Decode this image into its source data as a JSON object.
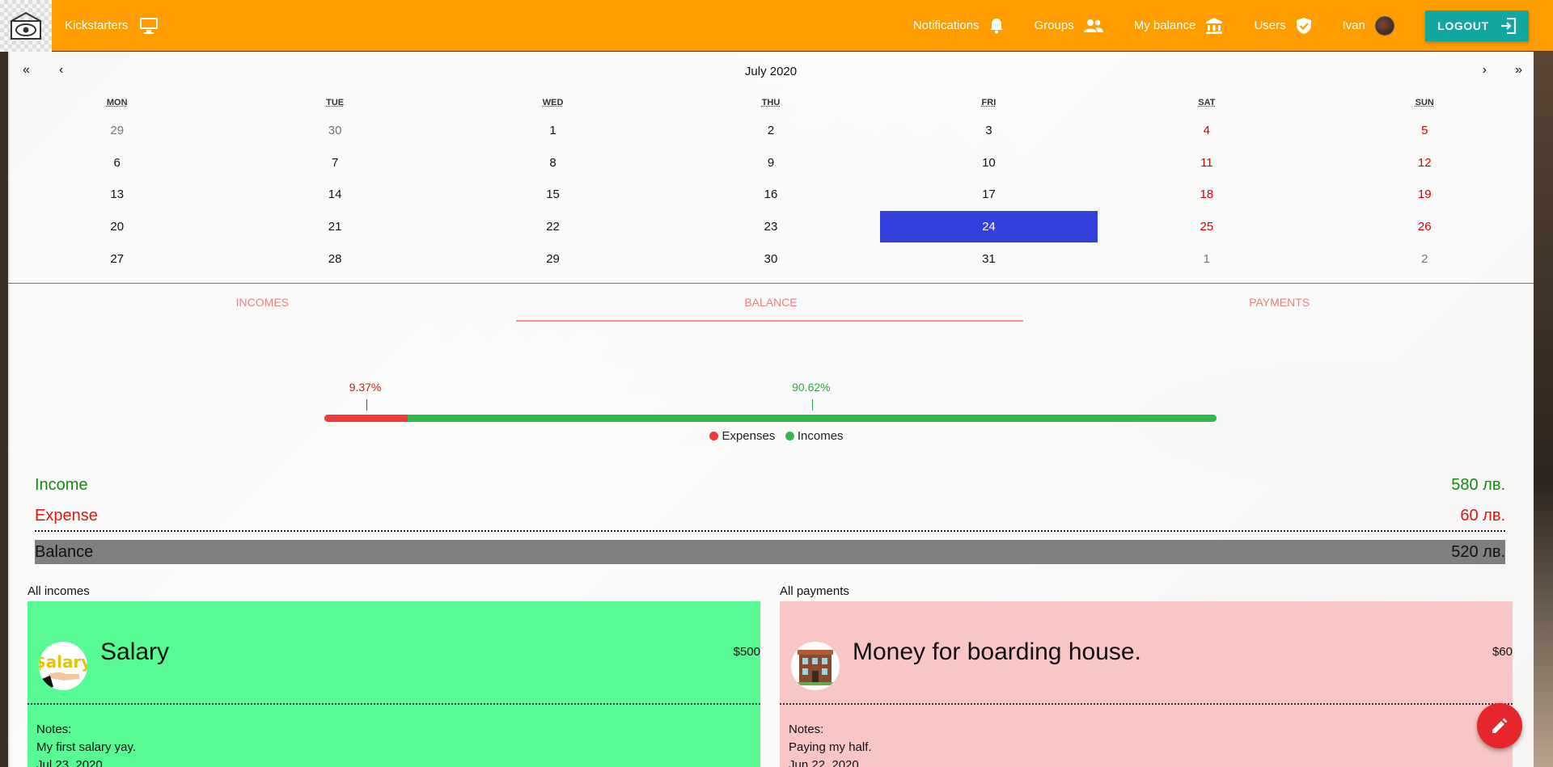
{
  "navbar": {
    "brand": "Kickstarters",
    "items": [
      {
        "label": "Notifications",
        "icon": "bell-icon"
      },
      {
        "label": "Groups",
        "icon": "groups-icon"
      },
      {
        "label": "My balance",
        "icon": "bank-icon"
      },
      {
        "label": "Users",
        "icon": "shield-check-icon"
      }
    ],
    "user": "Ivan",
    "logout": "LOGOUT",
    "color": "#ff9d00"
  },
  "calendar": {
    "title": "July 2020",
    "nav": {
      "prev_year": "«",
      "prev_month": "‹",
      "next_month": "›",
      "next_year": "»"
    },
    "weekdays": [
      "MON",
      "TUE",
      "WED",
      "THU",
      "FRI",
      "SAT",
      "SUN"
    ],
    "days": [
      {
        "d": "29",
        "t": "other"
      },
      {
        "d": "30",
        "t": "other"
      },
      {
        "d": "1",
        "t": ""
      },
      {
        "d": "2",
        "t": ""
      },
      {
        "d": "3",
        "t": ""
      },
      {
        "d": "4",
        "t": "weekend"
      },
      {
        "d": "5",
        "t": "weekend"
      },
      {
        "d": "6",
        "t": ""
      },
      {
        "d": "7",
        "t": ""
      },
      {
        "d": "8",
        "t": ""
      },
      {
        "d": "9",
        "t": ""
      },
      {
        "d": "10",
        "t": ""
      },
      {
        "d": "11",
        "t": "weekend"
      },
      {
        "d": "12",
        "t": "weekend"
      },
      {
        "d": "13",
        "t": ""
      },
      {
        "d": "14",
        "t": ""
      },
      {
        "d": "15",
        "t": ""
      },
      {
        "d": "16",
        "t": ""
      },
      {
        "d": "17",
        "t": ""
      },
      {
        "d": "18",
        "t": "weekend"
      },
      {
        "d": "19",
        "t": "weekend"
      },
      {
        "d": "20",
        "t": ""
      },
      {
        "d": "21",
        "t": ""
      },
      {
        "d": "22",
        "t": ""
      },
      {
        "d": "23",
        "t": ""
      },
      {
        "d": "24",
        "t": "selected"
      },
      {
        "d": "25",
        "t": "weekend"
      },
      {
        "d": "26",
        "t": "weekend"
      },
      {
        "d": "27",
        "t": ""
      },
      {
        "d": "28",
        "t": ""
      },
      {
        "d": "29",
        "t": ""
      },
      {
        "d": "30",
        "t": ""
      },
      {
        "d": "31",
        "t": ""
      },
      {
        "d": "1",
        "t": "other"
      },
      {
        "d": "2",
        "t": "other"
      }
    ],
    "selected_color": "#3341dc"
  },
  "tabs": [
    {
      "label": "INCOMES"
    },
    {
      "label": "BALANCE",
      "active": true
    },
    {
      "label": "PAYMENTS"
    }
  ],
  "balance_bar": {
    "expenses_pct_label": "9.37%",
    "incomes_pct_label": "90.62%",
    "expenses_fraction": 0.0937,
    "incomes_fraction": 0.9062,
    "legend": {
      "expenses": "Expenses",
      "incomes": "Incomes"
    },
    "colors": {
      "expenses": "#ee3a3a",
      "incomes": "#35b84b"
    }
  },
  "totals": {
    "income_label": "Income",
    "income_value": "580 лв.",
    "expense_label": "Expense",
    "expense_value": "60 лв.",
    "balance_label": "Balance",
    "balance_value": "520 лв."
  },
  "incomes": {
    "label": "All incomes",
    "card": {
      "title": "Salary",
      "amount": "$500",
      "notes_label": "Notes:",
      "notes": "My first salary yay.",
      "date": "Jul 23, 2020",
      "icon": "salary-icon",
      "icon_text": "$alary"
    }
  },
  "payments": {
    "label": "All payments",
    "card": {
      "title": "Money for boarding house.",
      "amount": "$60",
      "notes_label": "Notes:",
      "notes": "Paying my half.",
      "date": "Jun 22, 2020",
      "icon": "boarding-house-icon"
    }
  },
  "fab": {
    "icon": "edit-pencil-icon"
  }
}
